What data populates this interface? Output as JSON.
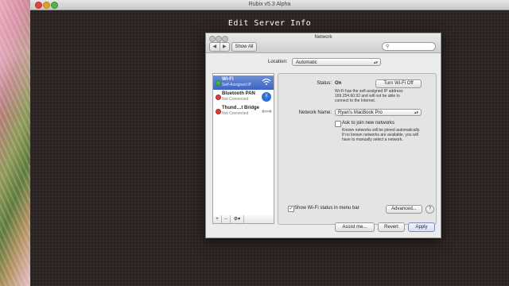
{
  "app": {
    "window_title": "Rubix v5.3 Alpha",
    "heading": "Edit Server Info"
  },
  "network_window": {
    "title": "Network",
    "nav_back": "◀",
    "nav_forward": "▶",
    "show_all": "Show All",
    "search_placeholder": "",
    "location_label": "Location:",
    "location_value": "Automatic",
    "services": [
      {
        "name": "Wi-Fi",
        "status": "Self-Assigned IP",
        "icon": "wifi-icon",
        "state_color": "#3cbb3c"
      },
      {
        "name": "Bluetooth PAN",
        "status": "Not Connected",
        "icon": "bluetooth-icon",
        "state_color": "#d64040"
      },
      {
        "name": "Thund…t Bridge",
        "status": "Not Connected",
        "icon": "thunderbolt-bridge-icon",
        "state_color": "#d64040"
      }
    ],
    "footer": {
      "add": "+",
      "remove": "−",
      "gear": "⚙▾"
    },
    "detail": {
      "status_label": "Status:",
      "status_value": "On",
      "turn_off_button": "Turn Wi-Fi Off",
      "status_description": [
        "Wi-Fi has the self-assigned IP address",
        "169.254.60.92 and will not be able to",
        "connect to the Internet."
      ],
      "network_name_label": "Network Name:",
      "network_name_value": "Ryan's MacBook Pro",
      "ask_join_label": "Ask to join new networks",
      "ask_join_checked": false,
      "ask_join_description": [
        "Known networks will be joined automatically.",
        "If no known networks are available, you will",
        "have to manually select a network."
      ],
      "show_status_label": "Show Wi-Fi status in menu bar",
      "show_status_checked": true,
      "advanced_button": "Advanced...",
      "help_button": "?"
    },
    "buttons": {
      "assist": "Assist me...",
      "revert": "Revert",
      "apply": "Apply"
    }
  }
}
